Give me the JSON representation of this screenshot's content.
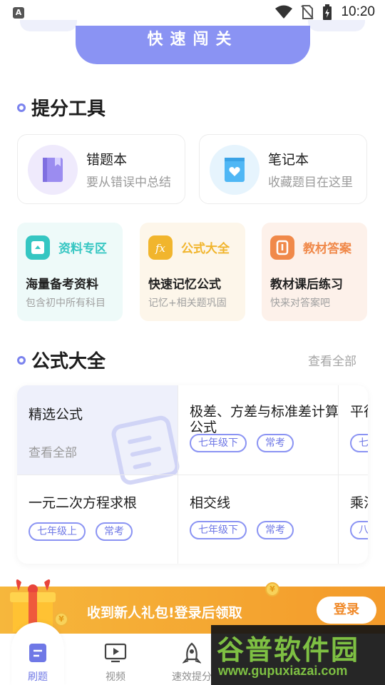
{
  "status_bar": {
    "time": "10:20",
    "app_badge": "A"
  },
  "top": {
    "quick_challenge": "快速闯关"
  },
  "tools_section": {
    "title": "提分工具",
    "cards": [
      {
        "name": "错题本",
        "sub": "要从错误中总结",
        "icon": "book-icon",
        "color": "#9b8cf0"
      },
      {
        "name": "笔记本",
        "sub": "收藏题目在这里",
        "icon": "heart-notebook-icon",
        "color": "#4fb7f5"
      }
    ]
  },
  "resources": [
    {
      "name": "资料专区",
      "line1": "海量备考资料",
      "line2": "包含初中所有科目",
      "icon": "folder-icon",
      "accent": "#35c6c2",
      "bg": "#eefaf9"
    },
    {
      "name": "公式大全",
      "line1": "快速记忆公式",
      "line2": "记忆+相关题巩固",
      "icon": "fx-icon",
      "accent": "#f1b52d",
      "bg": "#fdf6ea"
    },
    {
      "name": "教材答案",
      "line1": "教材课后练习",
      "line2": "快来对答案吧",
      "icon": "pencil-icon",
      "accent": "#f0894a",
      "bg": "#fdf1ea"
    }
  ],
  "formula_section": {
    "title": "公式大全",
    "view_all": "查看全部",
    "featured": {
      "title": "精选公式",
      "more": "查看全部"
    },
    "items": [
      {
        "name": "极差、方差与标准差计算公式",
        "tags": [
          "七年级下",
          "常考"
        ]
      },
      {
        "name": "平行",
        "tags": [
          "七"
        ]
      },
      {
        "name": "一元二次方程求根",
        "tags": [
          "七年级上",
          "常考"
        ]
      },
      {
        "name": "相交线",
        "tags": [
          "七年级下",
          "常考"
        ]
      },
      {
        "name": "乘法",
        "tags": [
          "八"
        ]
      }
    ]
  },
  "promo": {
    "text": "收到新人礼包!登录后领取",
    "login": "登录",
    "coin": "¥"
  },
  "bottom_nav": [
    {
      "label": "刷题",
      "icon": "practice-icon",
      "active": true
    },
    {
      "label": "视频",
      "icon": "video-icon",
      "active": false
    },
    {
      "label": "速效提分",
      "icon": "rocket-icon",
      "active": false
    }
  ],
  "watermark": {
    "cn": "谷普软件园",
    "url": "www.gupuxiazai.com"
  },
  "colors": {
    "accent": "#8a93f3",
    "promo": "#f6b73c"
  }
}
